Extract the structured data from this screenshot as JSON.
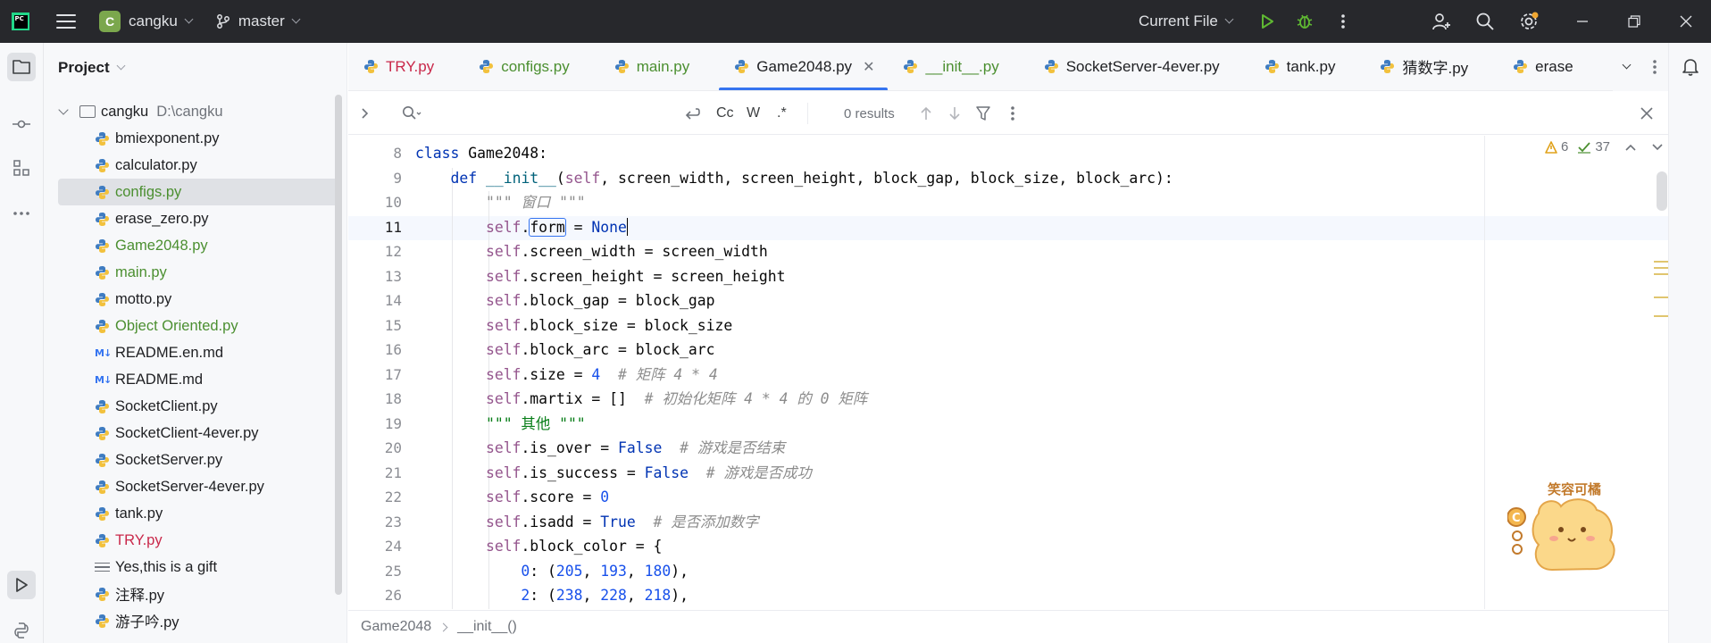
{
  "titlebar": {
    "project_initial": "C",
    "project_name": "cangku",
    "branch": "master",
    "run_config": "Current File"
  },
  "project_panel": {
    "title": "Project",
    "root": {
      "name": "cangku",
      "path": "D:\\cangku"
    },
    "files": [
      {
        "name": "bmiexponent.py",
        "type": "py",
        "color": "normal"
      },
      {
        "name": "calculator.py",
        "type": "py",
        "color": "normal"
      },
      {
        "name": "configs.py",
        "type": "py",
        "color": "green",
        "selected": true
      },
      {
        "name": "erase_zero.py",
        "type": "py",
        "color": "normal"
      },
      {
        "name": "Game2048.py",
        "type": "py",
        "color": "green"
      },
      {
        "name": "main.py",
        "type": "py",
        "color": "green"
      },
      {
        "name": "motto.py",
        "type": "py",
        "color": "normal"
      },
      {
        "name": "Object Oriented.py",
        "type": "py",
        "color": "green"
      },
      {
        "name": "README.en.md",
        "type": "md",
        "color": "normal"
      },
      {
        "name": "README.md",
        "type": "md",
        "color": "normal"
      },
      {
        "name": "SocketClient.py",
        "type": "py",
        "color": "normal"
      },
      {
        "name": "SocketClient-4ever.py",
        "type": "py",
        "color": "normal"
      },
      {
        "name": "SocketServer.py",
        "type": "py",
        "color": "normal"
      },
      {
        "name": "SocketServer-4ever.py",
        "type": "py",
        "color": "normal"
      },
      {
        "name": "tank.py",
        "type": "py",
        "color": "normal"
      },
      {
        "name": "TRY.py",
        "type": "py",
        "color": "red"
      },
      {
        "name": "Yes,this is a gift",
        "type": "txt",
        "color": "normal"
      },
      {
        "name": "注释.py",
        "type": "py",
        "color": "normal"
      },
      {
        "name": "游子吟.py",
        "type": "py",
        "color": "normal"
      }
    ]
  },
  "tabs": [
    {
      "label": "TRY.py",
      "color": "red"
    },
    {
      "label": "configs.py",
      "color": "green"
    },
    {
      "label": "main.py",
      "color": "green"
    },
    {
      "label": "Game2048.py",
      "color": "normal",
      "active": true
    },
    {
      "label": "__init__.py",
      "color": "green"
    },
    {
      "label": "SocketServer-4ever.py",
      "color": "normal"
    },
    {
      "label": "tank.py",
      "color": "normal"
    },
    {
      "label": "猜数字.py",
      "color": "normal"
    },
    {
      "label": "erase",
      "color": "normal"
    }
  ],
  "search": {
    "placeholder": "",
    "case_label": "Cc",
    "word_label": "W",
    "regex_label": ".*",
    "results": "0 results"
  },
  "inspections": {
    "warnings": "6",
    "ok": "37"
  },
  "code": {
    "first_line": 8,
    "current_line": 11,
    "lines": [
      "class Game2048:",
      "    def __init__(self, screen_width, screen_height, block_gap, block_size, block_arc):",
      "        \"\"\" 窗口 \"\"\"",
      "        self.form = None",
      "        self.screen_width = screen_width",
      "        self.screen_height = screen_height",
      "        self.block_gap = block_gap",
      "        self.block_size = block_size",
      "        self.block_arc = block_arc",
      "        self.size = 4  # 矩阵 4 * 4",
      "        self.martix = []  # 初始化矩阵 4 * 4 的 0 矩阵",
      "        \"\"\" 其他 \"\"\"",
      "        self.is_over = False  # 游戏是否结束",
      "        self.is_success = False  # 游戏是否成功",
      "        self.score = 0",
      "        self.isadd = True  # 是否添加数字",
      "        self.block_color = {",
      "            0: (205, 193, 180),",
      "            2: (238, 228, 218),"
    ]
  },
  "mascot_text": "笑容可橘",
  "breadcrumb": [
    "Game2048",
    "__init__()"
  ],
  "colors": {
    "accent": "#3574f0",
    "vcs_added": "#4b8f30",
    "vcs_error": "#c9284a",
    "titlebar_bg": "#27282c",
    "run": "#5fb832"
  }
}
